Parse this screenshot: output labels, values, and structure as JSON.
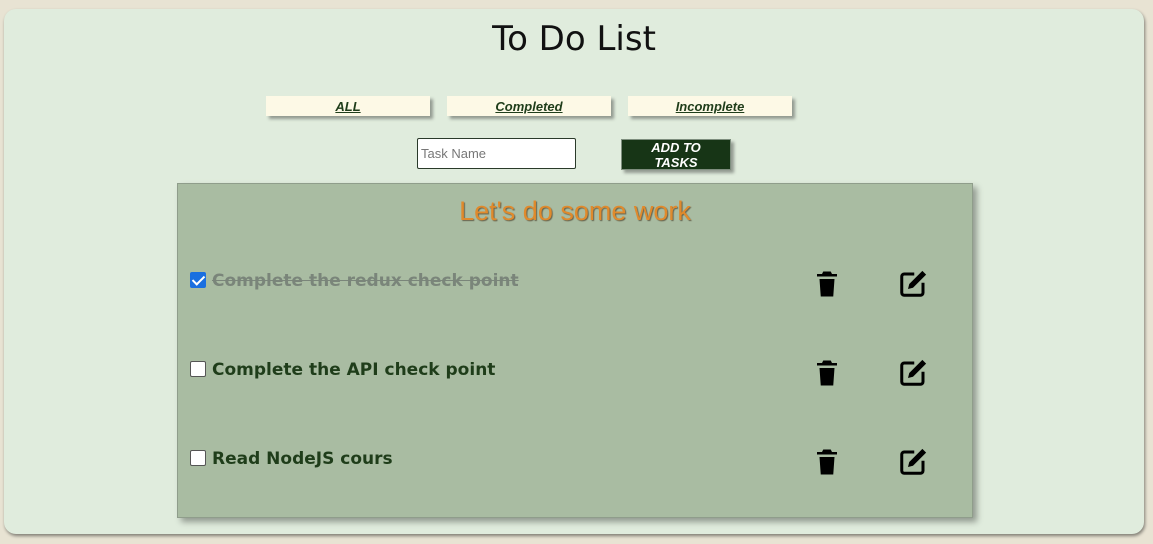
{
  "app": {
    "title": "To Do List"
  },
  "filters": [
    {
      "label": "ALL"
    },
    {
      "label": "Completed"
    },
    {
      "label": "Incomplete"
    }
  ],
  "new_task": {
    "placeholder": "Task Name",
    "value": "",
    "add_label": "ADD TO TASKS"
  },
  "panel": {
    "title": "Let's do some work"
  },
  "tasks": [
    {
      "label": "Complete the redux check point",
      "completed": true,
      "delete_icon": "trash-icon",
      "edit_icon": "edit-icon"
    },
    {
      "label": "Complete the API check point",
      "completed": false,
      "delete_icon": "trash-icon",
      "edit_icon": "edit-icon"
    },
    {
      "label": "Read NodeJS cours",
      "completed": false,
      "delete_icon": "trash-icon",
      "edit_icon": "edit-icon"
    }
  ],
  "colors": {
    "page_background": "#e0ecdd",
    "filter_button": "#fdf9e6",
    "add_button": "#173516",
    "panel_background": "#a9bca2",
    "panel_title": "#e08a2c",
    "task_text": "#1f3d1a"
  }
}
